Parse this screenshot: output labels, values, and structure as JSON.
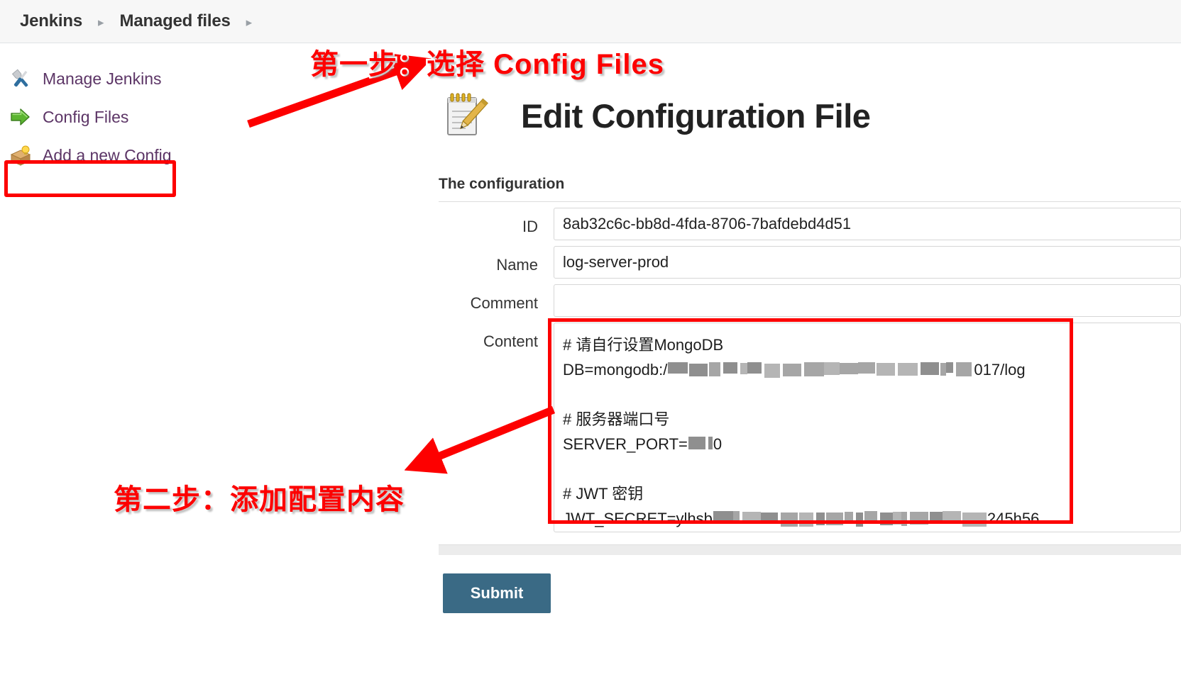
{
  "breadcrumb": {
    "items": [
      {
        "label": "Jenkins"
      },
      {
        "label": "Managed files"
      }
    ],
    "separator": "▸"
  },
  "sidebar": {
    "items": [
      {
        "label": "Manage Jenkins",
        "icon": "tools-icon"
      },
      {
        "label": "Config Files",
        "icon": "green-arrow-icon",
        "highlighted": true
      },
      {
        "label": "Add a new Config",
        "icon": "box-idea-icon"
      }
    ]
  },
  "main": {
    "icon": "notepad-pencil-icon",
    "title": "Edit Configuration File",
    "section_title": "The configuration",
    "fields": [
      {
        "label": "ID",
        "value": "8ab32c6c-bb8d-4fda-8706-7bafdebd4d51",
        "type": "text"
      },
      {
        "label": "Name",
        "value": "log-server-prod",
        "type": "text"
      },
      {
        "label": "Comment",
        "value": "",
        "type": "text"
      },
      {
        "label": "Content",
        "value": "",
        "type": "textarea"
      }
    ],
    "content_lines": [
      {
        "text": "# 请自行设置MongoDB"
      },
      {
        "prefix": "DB=mongodb:/",
        "censored": true,
        "suffix": "017/log"
      },
      {
        "text": ""
      },
      {
        "text": "# 服务器端口号"
      },
      {
        "prefix": "SERVER_PORT=",
        "censored": true,
        "suffix": "0"
      },
      {
        "text": ""
      },
      {
        "text": "# JWT 密钥"
      },
      {
        "prefix": "JWT_SECRET=ylhsb",
        "censored": true,
        "suffix": "245h56"
      }
    ],
    "submit_label": "Submit"
  },
  "annotations": [
    {
      "id": "step1",
      "text": "第一步：选择 Config Files"
    },
    {
      "id": "step2",
      "text": "第二步：添加配置内容"
    }
  ],
  "colors": {
    "annotation_red": "#fd0000",
    "submit_button": "#3a6a85",
    "sidebar_link": "#5c3566",
    "breadcrumb_bg": "#f7f7f7"
  }
}
